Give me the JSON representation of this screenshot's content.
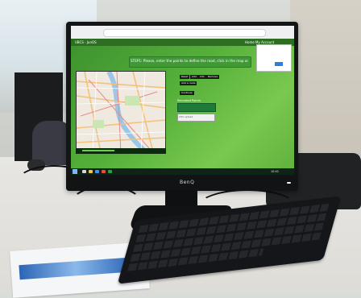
{
  "scene": {
    "monitor_brand": "BenQ"
  },
  "browser": {
    "app_title": "UBCS · JunOS",
    "nav_items": [
      "Home",
      "My Account"
    ]
  },
  "app": {
    "step_banner": "STEP1: Please, enter the points to define the road, click in the map or select CSV",
    "buttons": [
      "Reset",
      "Add",
      "Info",
      "Remove",
      "Add a route",
      "Continue"
    ],
    "output_label": "Recorded Points",
    "input_label": "CSV upload"
  },
  "taskbar": {
    "time": "10:42"
  },
  "colors": {
    "screen_green": "#55b03a",
    "banner_green": "#3f9a35",
    "bezel": "#141517"
  }
}
